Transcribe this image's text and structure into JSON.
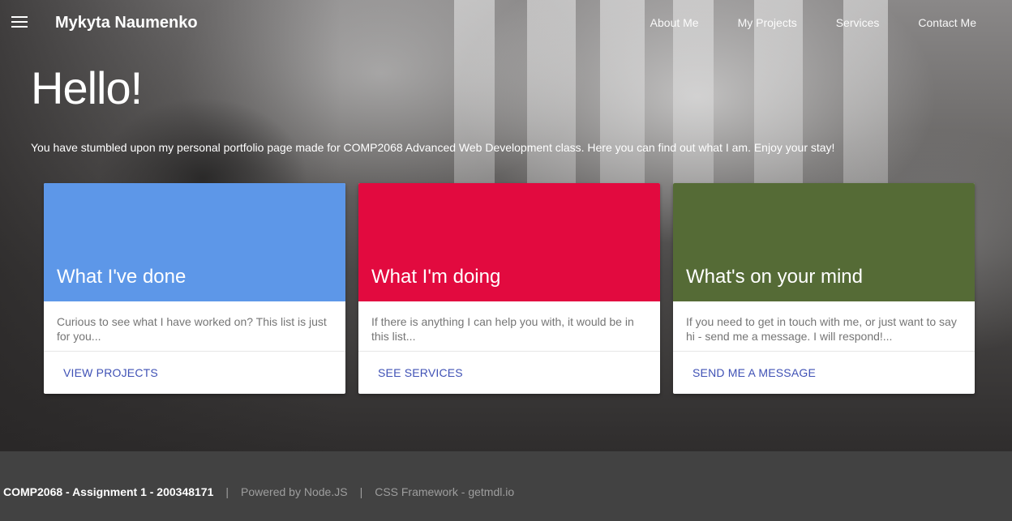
{
  "header": {
    "title": "Mykyta Naumenko",
    "menu_icon": "hamburger-menu-icon",
    "nav": [
      "About Me",
      "My Projects",
      "Services",
      "Contact Me"
    ]
  },
  "hero": {
    "heading": "Hello!",
    "intro": "You have stumbled upon my personal portfolio page made for COMP2068 Advanced Web Development class. Here you can find out what I am. Enjoy your stay!"
  },
  "cards": [
    {
      "title": "What I've done",
      "text": "Curious to see what I have worked on? This list is just for you...",
      "action": "View Projects",
      "color": "#5d97e8"
    },
    {
      "title": "What I'm doing",
      "text": "If there is anything I can help you with, it would be in this list...",
      "action": "See Services",
      "color": "#e20a3f"
    },
    {
      "title": "What's on your mind",
      "text": "If you need to get in touch with me, or just want to say hi - send me a message. I will respond!...",
      "action": "Send me a message",
      "color": "#556b36"
    }
  ],
  "footer": {
    "assignment": "COMP2068 - Assignment 1 - 200348171",
    "separator": "|",
    "powered": "Powered by Node.JS",
    "framework": "CSS Framework - getmdl.io"
  },
  "colors": {
    "link": "#3f51b5",
    "footer_bg": "#424242"
  }
}
